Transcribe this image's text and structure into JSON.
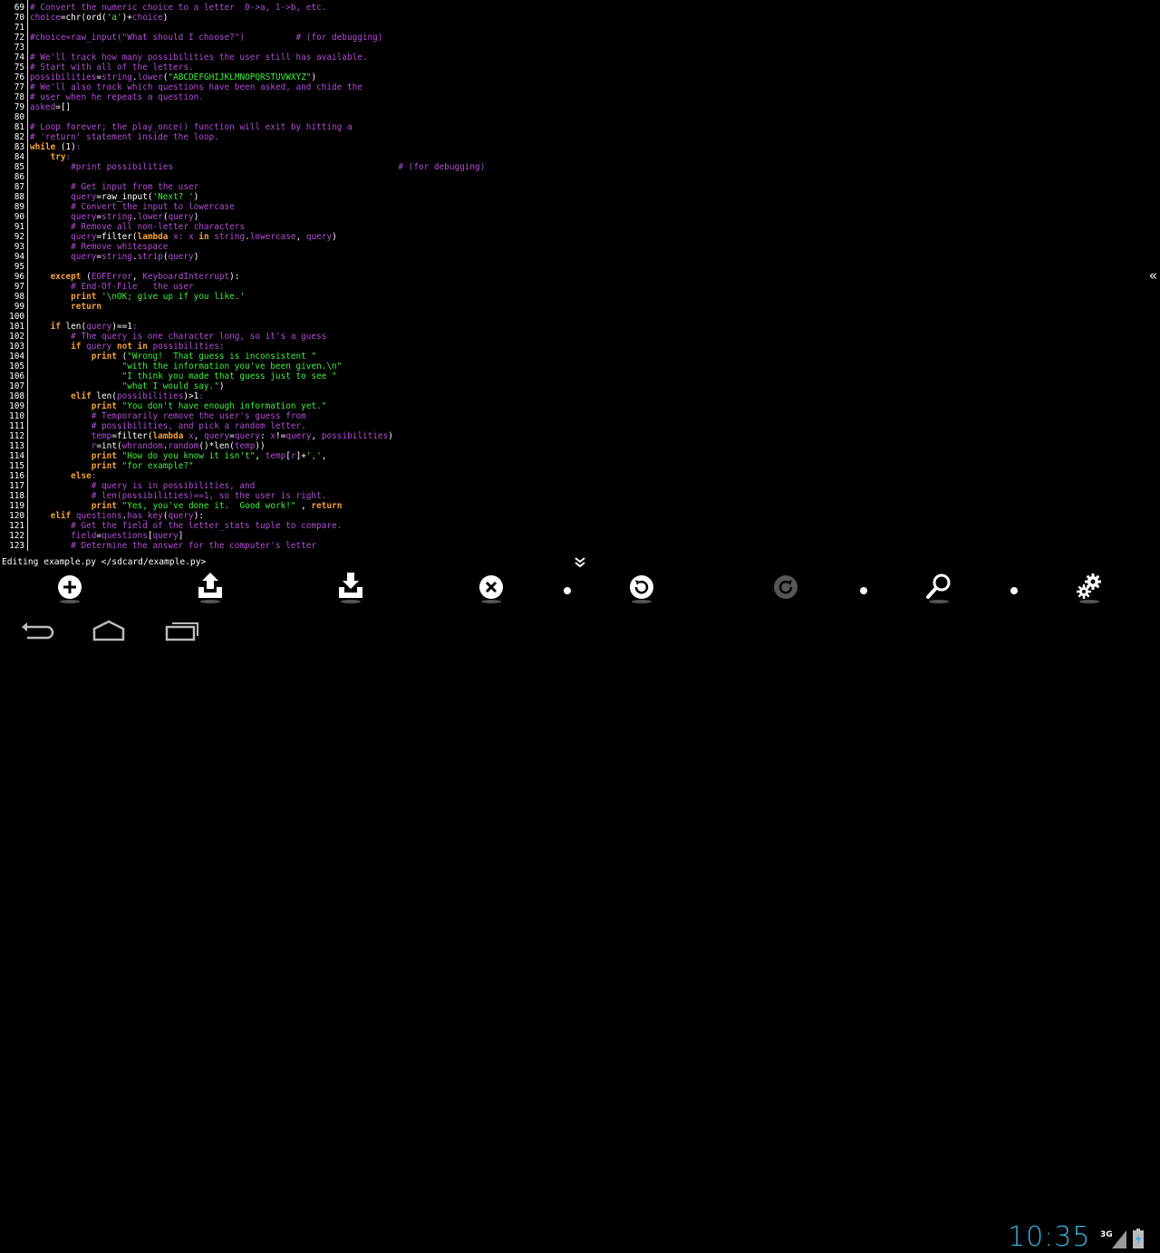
{
  "colors": {
    "comment": "#b14ed3",
    "keyword": "#f3a037",
    "string": "#3ef03e",
    "text": "#ffffff",
    "accent": "#33b5e5"
  },
  "code_lines": [
    {
      "n": "69",
      "segs": [
        [
          "c",
          "# Convert the numeric choice to a letter  0->a, 1->b, etc."
        ]
      ]
    },
    {
      "n": "70",
      "segs": [
        [
          "a",
          "choice"
        ],
        [
          "p",
          "=chr(ord("
        ],
        [
          "s",
          "'a'"
        ],
        [
          "p",
          ")+"
        ],
        [
          "a",
          "choice"
        ],
        [
          "p",
          ")"
        ]
      ]
    },
    {
      "n": "71",
      "segs": []
    },
    {
      "n": "72",
      "segs": [
        [
          "c",
          "#choice=raw_input(\"What should I choose?\")          # (for debugging)"
        ]
      ]
    },
    {
      "n": "73",
      "segs": []
    },
    {
      "n": "74",
      "segs": [
        [
          "c",
          "# We'll track how many possibilities the user still has available."
        ]
      ]
    },
    {
      "n": "75",
      "segs": [
        [
          "c",
          "# Start with all of the letters."
        ]
      ]
    },
    {
      "n": "76",
      "segs": [
        [
          "a",
          "possibilities"
        ],
        [
          "p",
          "="
        ],
        [
          "a",
          "string"
        ],
        [
          "p",
          "."
        ],
        [
          "a",
          "lower"
        ],
        [
          "p",
          "("
        ],
        [
          "s",
          "\"ABCDEFGHIJKLMNOPQRSTUVWXYZ\""
        ],
        [
          "p",
          ")"
        ]
      ]
    },
    {
      "n": "77",
      "segs": [
        [
          "c",
          "# We'll also track which questions have been asked, and chide the"
        ]
      ]
    },
    {
      "n": "78",
      "segs": [
        [
          "c",
          "# user when he repeats a question."
        ]
      ]
    },
    {
      "n": "79",
      "segs": [
        [
          "a",
          "asked"
        ],
        [
          "p",
          "=[]"
        ]
      ]
    },
    {
      "n": "80",
      "segs": []
    },
    {
      "n": "81",
      "segs": [
        [
          "c",
          "# Loop forever; the play_once() function will exit by hitting a"
        ]
      ]
    },
    {
      "n": "82",
      "segs": [
        [
          "c",
          "# 'return' statement inside the loop."
        ]
      ]
    },
    {
      "n": "83",
      "segs": [
        [
          "k",
          "while"
        ],
        [
          "p",
          " (1)"
        ],
        [
          "a",
          ":"
        ]
      ]
    },
    {
      "n": "84",
      "segs": [
        [
          "p",
          "    "
        ],
        [
          "k",
          "try"
        ],
        [
          "a",
          ":"
        ]
      ]
    },
    {
      "n": "85",
      "segs": [
        [
          "c",
          "        #print possibilities                                            # (for debugging)"
        ]
      ]
    },
    {
      "n": "86",
      "segs": []
    },
    {
      "n": "87",
      "segs": [
        [
          "c",
          "        # Get input from the user"
        ]
      ]
    },
    {
      "n": "88",
      "segs": [
        [
          "p",
          "        "
        ],
        [
          "a",
          "query"
        ],
        [
          "p",
          "=raw_input("
        ],
        [
          "s",
          "'Next? '"
        ],
        [
          "p",
          ")"
        ]
      ]
    },
    {
      "n": "89",
      "segs": [
        [
          "c",
          "        # Convert the input to lowercase"
        ]
      ]
    },
    {
      "n": "90",
      "segs": [
        [
          "p",
          "        "
        ],
        [
          "a",
          "query"
        ],
        [
          "p",
          "="
        ],
        [
          "a",
          "string"
        ],
        [
          "p",
          "."
        ],
        [
          "a",
          "lower"
        ],
        [
          "p",
          "("
        ],
        [
          "a",
          "query"
        ],
        [
          "p",
          ")"
        ]
      ]
    },
    {
      "n": "91",
      "segs": [
        [
          "c",
          "        # Remove all non-letter characters"
        ]
      ]
    },
    {
      "n": "92",
      "segs": [
        [
          "p",
          "        "
        ],
        [
          "a",
          "query"
        ],
        [
          "p",
          "=filter("
        ],
        [
          "k",
          "lambda"
        ],
        [
          "a",
          " x: x "
        ],
        [
          "k",
          "in"
        ],
        [
          "p",
          " "
        ],
        [
          "a",
          "string"
        ],
        [
          "p",
          "."
        ],
        [
          "a",
          "lowercase"
        ],
        [
          "p",
          ", "
        ],
        [
          "a",
          "query"
        ],
        [
          "p",
          ")"
        ]
      ]
    },
    {
      "n": "93",
      "segs": [
        [
          "c",
          "        # Remove whitespace"
        ]
      ]
    },
    {
      "n": "94",
      "segs": [
        [
          "p",
          "        "
        ],
        [
          "a",
          "query"
        ],
        [
          "p",
          "="
        ],
        [
          "a",
          "string"
        ],
        [
          "p",
          "."
        ],
        [
          "a",
          "strip"
        ],
        [
          "p",
          "("
        ],
        [
          "a",
          "query"
        ],
        [
          "p",
          ")"
        ]
      ]
    },
    {
      "n": "95",
      "segs": []
    },
    {
      "n": "96",
      "segs": [
        [
          "p",
          "    "
        ],
        [
          "k",
          "except"
        ],
        [
          "p",
          " ("
        ],
        [
          "a",
          "EOFError"
        ],
        [
          "p",
          ", "
        ],
        [
          "a",
          "KeyboardInterrupt"
        ],
        [
          "p",
          "):"
        ]
      ]
    },
    {
      "n": "97",
      "segs": [
        [
          "c",
          "        # End-Of-File   the user"
        ]
      ]
    },
    {
      "n": "98",
      "segs": [
        [
          "p",
          "        "
        ],
        [
          "k",
          "print"
        ],
        [
          "p",
          " "
        ],
        [
          "s",
          "'\\nOK; give up if you like.'"
        ]
      ]
    },
    {
      "n": "99",
      "segs": [
        [
          "p",
          "        "
        ],
        [
          "k",
          "return"
        ]
      ]
    },
    {
      "n": "100",
      "segs": []
    },
    {
      "n": "101",
      "segs": [
        [
          "p",
          "    "
        ],
        [
          "k",
          "if"
        ],
        [
          "p",
          " len("
        ],
        [
          "a",
          "query"
        ],
        [
          "p",
          ")==1"
        ],
        [
          "a",
          ":"
        ]
      ]
    },
    {
      "n": "102",
      "segs": [
        [
          "c",
          "        # The query is one character long, so it's a guess"
        ]
      ]
    },
    {
      "n": "103",
      "segs": [
        [
          "p",
          "        "
        ],
        [
          "k",
          "if"
        ],
        [
          "p",
          " "
        ],
        [
          "a",
          "query"
        ],
        [
          "p",
          " "
        ],
        [
          "k",
          "not in"
        ],
        [
          "p",
          " "
        ],
        [
          "a",
          "possibilities"
        ],
        [
          "a",
          ":"
        ]
      ]
    },
    {
      "n": "104",
      "segs": [
        [
          "p",
          "            "
        ],
        [
          "k",
          "print"
        ],
        [
          "p",
          " ("
        ],
        [
          "s",
          "\"Wrong!  That guess is inconsistent \""
        ]
      ]
    },
    {
      "n": "105",
      "segs": [
        [
          "p",
          "                  "
        ],
        [
          "s",
          "\"with the information you've been given.\\n\""
        ]
      ]
    },
    {
      "n": "106",
      "segs": [
        [
          "p",
          "                  "
        ],
        [
          "s",
          "\"I think you made that guess just to see \""
        ]
      ]
    },
    {
      "n": "107",
      "segs": [
        [
          "p",
          "                  "
        ],
        [
          "s",
          "\"what I would say.\""
        ],
        [
          "p",
          ")"
        ]
      ]
    },
    {
      "n": "108",
      "segs": [
        [
          "p",
          "        "
        ],
        [
          "k",
          "elif"
        ],
        [
          "p",
          " len("
        ],
        [
          "a",
          "possibilities"
        ],
        [
          "p",
          ")>1"
        ],
        [
          "a",
          ":"
        ]
      ]
    },
    {
      "n": "109",
      "segs": [
        [
          "p",
          "            "
        ],
        [
          "k",
          "print"
        ],
        [
          "p",
          " "
        ],
        [
          "s",
          "\"You don't have enough information yet.\""
        ]
      ]
    },
    {
      "n": "110",
      "segs": [
        [
          "c",
          "            # Temporarily remove the user's guess from"
        ]
      ]
    },
    {
      "n": "111",
      "segs": [
        [
          "c",
          "            # possibilities, and pick a random letter."
        ]
      ]
    },
    {
      "n": "112",
      "segs": [
        [
          "p",
          "            "
        ],
        [
          "a",
          "temp"
        ],
        [
          "p",
          "=filter("
        ],
        [
          "k",
          "lambda"
        ],
        [
          "a",
          " x"
        ],
        [
          "p",
          ", "
        ],
        [
          "a",
          "query"
        ],
        [
          "p",
          "="
        ],
        [
          "a",
          "query"
        ],
        [
          "p",
          ": "
        ],
        [
          "a",
          "x"
        ],
        [
          "p",
          "!="
        ],
        [
          "a",
          "query"
        ],
        [
          "p",
          ", "
        ],
        [
          "a",
          "possibilities"
        ],
        [
          "p",
          ")"
        ]
      ]
    },
    {
      "n": "113",
      "segs": [
        [
          "p",
          "            "
        ],
        [
          "a",
          "r"
        ],
        [
          "p",
          "=int("
        ],
        [
          "a",
          "whrandom"
        ],
        [
          "p",
          "."
        ],
        [
          "a",
          "random"
        ],
        [
          "p",
          "()*len("
        ],
        [
          "a",
          "temp"
        ],
        [
          "p",
          "))"
        ]
      ]
    },
    {
      "n": "114",
      "segs": [
        [
          "p",
          "            "
        ],
        [
          "k",
          "print"
        ],
        [
          "p",
          " "
        ],
        [
          "s",
          "\"How do you know it isn't\""
        ],
        [
          "p",
          ", "
        ],
        [
          "a",
          "temp"
        ],
        [
          "p",
          "["
        ],
        [
          "a",
          "r"
        ],
        [
          "p",
          "]+"
        ],
        [
          "s",
          "','"
        ],
        [
          "p",
          ","
        ]
      ]
    },
    {
      "n": "115",
      "segs": [
        [
          "p",
          "            "
        ],
        [
          "k",
          "print"
        ],
        [
          "p",
          " "
        ],
        [
          "s",
          "\"for example?\""
        ]
      ]
    },
    {
      "n": "116",
      "segs": [
        [
          "p",
          "        "
        ],
        [
          "k",
          "else"
        ],
        [
          "a",
          ":"
        ]
      ]
    },
    {
      "n": "117",
      "segs": [
        [
          "c",
          "            # query is in possibilities, and"
        ]
      ]
    },
    {
      "n": "118",
      "segs": [
        [
          "c",
          "            # len(possibilities)==1, so the user is right."
        ]
      ]
    },
    {
      "n": "119",
      "segs": [
        [
          "p",
          "            "
        ],
        [
          "k",
          "print"
        ],
        [
          "p",
          " "
        ],
        [
          "s",
          "\"Yes, you've done it.  Good work!\""
        ],
        [
          "p",
          " , "
        ],
        [
          "k",
          "return"
        ]
      ]
    },
    {
      "n": "120",
      "segs": [
        [
          "p",
          "    "
        ],
        [
          "k",
          "elif"
        ],
        [
          "p",
          " "
        ],
        [
          "a",
          "questions"
        ],
        [
          "p",
          "."
        ],
        [
          "a",
          "has_key"
        ],
        [
          "p",
          "("
        ],
        [
          "a",
          "query"
        ],
        [
          "p",
          "):"
        ]
      ]
    },
    {
      "n": "121",
      "segs": [
        [
          "c",
          "        # Get the field of the letter_stats tuple to compare."
        ]
      ]
    },
    {
      "n": "122",
      "segs": [
        [
          "p",
          "        "
        ],
        [
          "a",
          "field"
        ],
        [
          "p",
          "="
        ],
        [
          "a",
          "questions"
        ],
        [
          "p",
          "["
        ],
        [
          "a",
          "query"
        ],
        [
          "p",
          "]"
        ]
      ]
    },
    {
      "n": "123",
      "segs": [
        [
          "c",
          "        # Determine the answer for the computer's letter"
        ]
      ]
    }
  ],
  "status": {
    "text": "Editing example.py </sdcard/example.py>"
  },
  "toolbar": {
    "buttons": [
      {
        "name": "new-file-button",
        "icon": "plus-circle-icon"
      },
      {
        "name": "upload-button",
        "icon": "upload-icon"
      },
      {
        "name": "download-button",
        "icon": "download-icon"
      },
      {
        "name": "close-file-button",
        "icon": "close-circle-icon"
      },
      {
        "name": "undo-button",
        "icon": "undo-icon"
      },
      {
        "name": "redo-button",
        "icon": "redo-icon"
      },
      {
        "name": "search-button",
        "icon": "search-icon"
      },
      {
        "name": "settings-button",
        "icon": "gear-icon"
      }
    ]
  },
  "system": {
    "clock": "10:35",
    "network": "3G"
  }
}
